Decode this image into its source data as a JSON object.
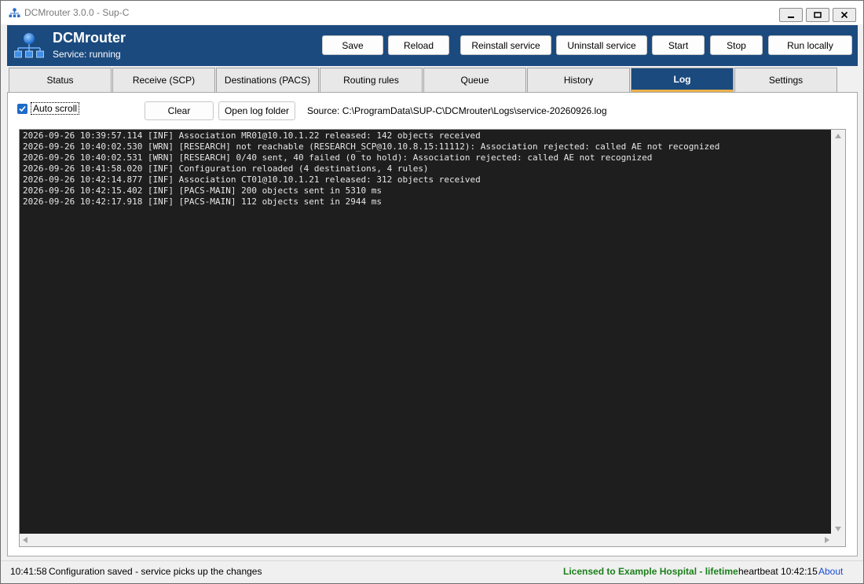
{
  "window": {
    "title": "DCMrouter 3.0.0 - Sup-C"
  },
  "header": {
    "app_name": "DCMrouter",
    "service_status": "Service: running",
    "buttons": {
      "save": "Save",
      "reload": "Reload",
      "reinstall": "Reinstall service",
      "uninstall": "Uninstall service",
      "start": "Start",
      "stop": "Stop",
      "run_locally": "Run locally"
    }
  },
  "tabs": [
    {
      "label": "Status"
    },
    {
      "label": "Receive (SCP)"
    },
    {
      "label": "Destinations (PACS)"
    },
    {
      "label": "Routing rules"
    },
    {
      "label": "Queue"
    },
    {
      "label": "History"
    },
    {
      "label": "Log",
      "active": true
    },
    {
      "label": "Settings"
    }
  ],
  "log_panel": {
    "auto_scroll_label": "Auto scroll",
    "auto_scroll_checked": true,
    "clear_label": "Clear",
    "open_folder_label": "Open log folder",
    "source_path": "Source: C:\\ProgramData\\SUP-C\\DCMrouter\\Logs\\service-20260926.log",
    "lines": [
      "2026-09-26 10:39:57.114 [INF] Association MR01@10.10.1.22 released: 142 objects received",
      "2026-09-26 10:40:02.530 [WRN] [RESEARCH] not reachable (RESEARCH_SCP@10.10.8.15:11112): Association rejected: called AE not recognized",
      "2026-09-26 10:40:02.531 [WRN] [RESEARCH] 0/40 sent, 40 failed (0 to hold): Association rejected: called AE not recognized",
      "2026-09-26 10:41:58.020 [INF] Configuration reloaded (4 destinations, 4 rules)",
      "2026-09-26 10:42:14.877 [INF] Association CT01@10.10.1.21 released: 312 objects received",
      "2026-09-26 10:42:15.402 [INF] [PACS-MAIN] 200 objects sent in 5310 ms",
      "2026-09-26 10:42:17.918 [INF] [PACS-MAIN] 112 objects sent in 2944 ms"
    ]
  },
  "statusbar": {
    "time": "10:41:58",
    "message": "Configuration saved - service picks up the changes",
    "license": "Licensed to Example Hospital - lifetime",
    "heartbeat": "heartbeat 10:42:15",
    "about": "About"
  },
  "colors": {
    "header_bg": "#1b4a7e",
    "active_tab_underline": "#e8b04b",
    "log_bg": "#1e1e1e",
    "license_green": "#1a7f1a",
    "link_blue": "#1a4bd6"
  }
}
